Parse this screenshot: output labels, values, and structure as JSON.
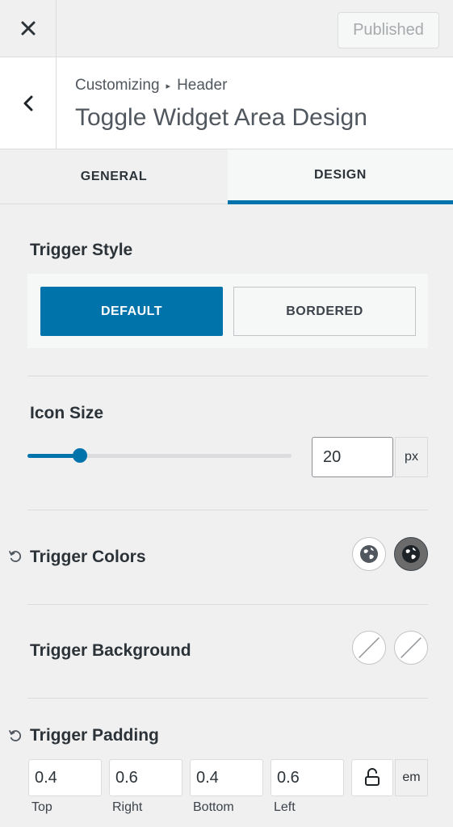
{
  "header": {
    "close_icon": "close-icon",
    "publish_label": "Published"
  },
  "section": {
    "back_icon": "chevron-left-icon",
    "breadcrumb_parent": "Customizing",
    "breadcrumb_separator": "▸",
    "breadcrumb_current": "Header",
    "title": "Toggle Widget Area Design"
  },
  "tabs": [
    {
      "label": "GENERAL",
      "active": false
    },
    {
      "label": "DESIGN",
      "active": true
    }
  ],
  "trigger_style": {
    "label": "Trigger Style",
    "options": [
      "DEFAULT",
      "BORDERED"
    ],
    "selected": "DEFAULT"
  },
  "icon_size": {
    "label": "Icon Size",
    "value": "20",
    "unit": "px",
    "slider_fraction": 0.2
  },
  "trigger_colors": {
    "label": "Trigger Colors",
    "reset_icon": "reset-icon",
    "swatches": [
      "global-color-icon",
      "global-color-hover-icon"
    ]
  },
  "trigger_background": {
    "label": "Trigger Background",
    "swatches": [
      "no-color-icon",
      "no-color-hover-icon"
    ]
  },
  "trigger_padding": {
    "label": "Trigger Padding",
    "reset_icon": "reset-icon",
    "fields": [
      {
        "value": "0.4",
        "label": "Top"
      },
      {
        "value": "0.6",
        "label": "Right"
      },
      {
        "value": "0.4",
        "label": "Bottom"
      },
      {
        "value": "0.6",
        "label": "Left"
      }
    ],
    "lock_icon": "unlock-icon",
    "unit": "em"
  },
  "colors": {
    "accent": "#0073aa",
    "background": "#f0f0f1",
    "border": "#dcdcde"
  }
}
